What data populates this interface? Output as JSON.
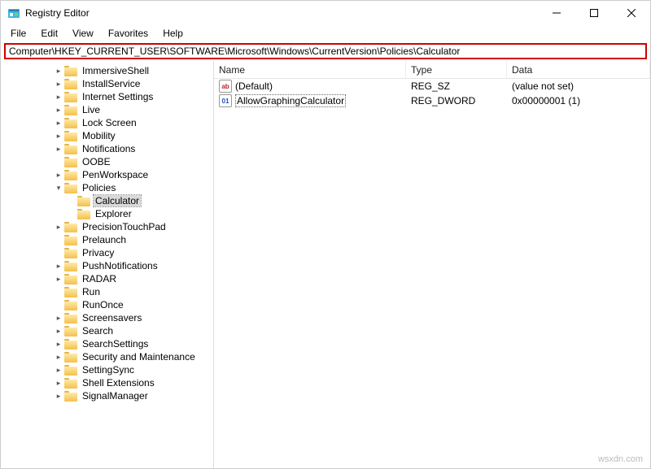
{
  "window": {
    "title": "Registry Editor"
  },
  "menu": {
    "file": "File",
    "edit": "Edit",
    "view": "View",
    "favorites": "Favorites",
    "help": "Help"
  },
  "address": "Computer\\HKEY_CURRENT_USER\\SOFTWARE\\Microsoft\\Windows\\CurrentVersion\\Policies\\Calculator",
  "tree": {
    "items": [
      {
        "label": "ImmersiveShell",
        "indent": 4,
        "expander": "right"
      },
      {
        "label": "InstallService",
        "indent": 4,
        "expander": "right"
      },
      {
        "label": "Internet Settings",
        "indent": 4,
        "expander": "right"
      },
      {
        "label": "Live",
        "indent": 4,
        "expander": "right"
      },
      {
        "label": "Lock Screen",
        "indent": 4,
        "expander": "right"
      },
      {
        "label": "Mobility",
        "indent": 4,
        "expander": "right"
      },
      {
        "label": "Notifications",
        "indent": 4,
        "expander": "right"
      },
      {
        "label": "OOBE",
        "indent": 4,
        "expander": ""
      },
      {
        "label": "PenWorkspace",
        "indent": 4,
        "expander": "right"
      },
      {
        "label": "Policies",
        "indent": 4,
        "expander": "down"
      },
      {
        "label": "Calculator",
        "indent": 5,
        "expander": "",
        "selected": true
      },
      {
        "label": "Explorer",
        "indent": 5,
        "expander": ""
      },
      {
        "label": "PrecisionTouchPad",
        "indent": 4,
        "expander": "right"
      },
      {
        "label": "Prelaunch",
        "indent": 4,
        "expander": ""
      },
      {
        "label": "Privacy",
        "indent": 4,
        "expander": ""
      },
      {
        "label": "PushNotifications",
        "indent": 4,
        "expander": "right"
      },
      {
        "label": "RADAR",
        "indent": 4,
        "expander": "right"
      },
      {
        "label": "Run",
        "indent": 4,
        "expander": ""
      },
      {
        "label": "RunOnce",
        "indent": 4,
        "expander": ""
      },
      {
        "label": "Screensavers",
        "indent": 4,
        "expander": "right"
      },
      {
        "label": "Search",
        "indent": 4,
        "expander": "right"
      },
      {
        "label": "SearchSettings",
        "indent": 4,
        "expander": "right"
      },
      {
        "label": "Security and Maintenance",
        "indent": 4,
        "expander": "right"
      },
      {
        "label": "SettingSync",
        "indent": 4,
        "expander": "right"
      },
      {
        "label": "Shell Extensions",
        "indent": 4,
        "expander": "right"
      },
      {
        "label": "SignalManager",
        "indent": 4,
        "expander": "right"
      }
    ]
  },
  "list": {
    "columns": {
      "name": "Name",
      "type": "Type",
      "data": "Data"
    },
    "rows": [
      {
        "icon": "sz",
        "icon_text": "ab",
        "name": "(Default)",
        "type": "REG_SZ",
        "data": "(value not set)",
        "selected": false
      },
      {
        "icon": "dw",
        "icon_text": "011\n110",
        "name": "AllowGraphingCalculator",
        "type": "REG_DWORD",
        "data": "0x00000001 (1)",
        "selected": true
      }
    ]
  },
  "watermark": "wsxdn.com"
}
